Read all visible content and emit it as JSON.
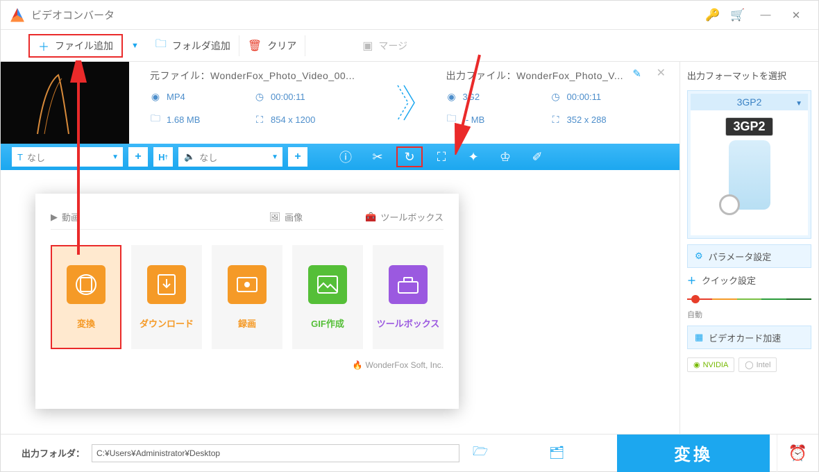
{
  "titlebar": {
    "title": "ビデオコンバータ"
  },
  "toolbar": {
    "add_file": "ファイル追加",
    "add_folder": "フォルダ追加",
    "clear": "クリア",
    "merge": "マージ"
  },
  "file": {
    "src_label": "元ファイル：",
    "src_name": "WonderFox_Photo_Video_00...",
    "out_label": "出力ファイル：",
    "out_name": "WonderFox_Photo_V...",
    "src": {
      "format": "MP4",
      "duration": "00:00:11",
      "size": "1.68 MB",
      "dims": "854 x 1200"
    },
    "out": {
      "format": "3G2",
      "duration": "00:00:11",
      "size": "-- MB",
      "dims": "352 x 288"
    }
  },
  "bluebar": {
    "sub_none": "なし",
    "audio_none": "なし"
  },
  "popup": {
    "tab_video": "動画",
    "tab_image": "画像",
    "tab_tool": "ツールボックス",
    "cards": [
      "変換",
      "ダウンロード",
      "録画",
      "GIF作成",
      "ツールボックス"
    ],
    "brand": "WonderFox Soft, Inc."
  },
  "right": {
    "title": "出力フォーマットを選択",
    "format": "3GP2",
    "badge": "3GP2",
    "param": "パラメータ設定",
    "quick": "クイック設定",
    "slider_label": "自動",
    "gpu": "ビデオカード加速",
    "nvidia": "NVIDIA",
    "intel": "Intel"
  },
  "footer": {
    "label": "出力フォルダ：",
    "path": "C:¥Users¥Administrator¥Desktop",
    "convert": "変換"
  }
}
